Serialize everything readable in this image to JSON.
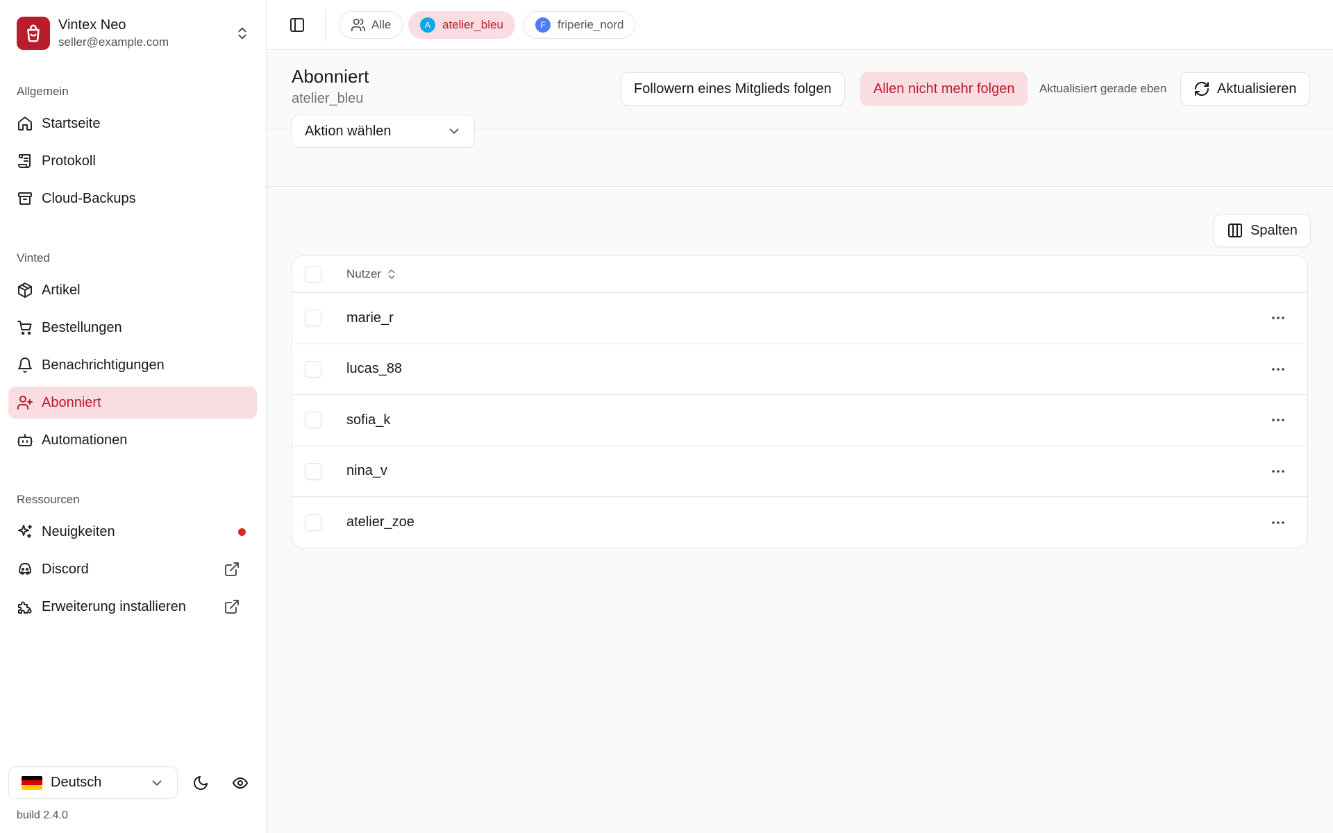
{
  "account": {
    "name": "Vintex Neo",
    "email": "seller@example.com"
  },
  "sidebar": {
    "sections": [
      {
        "label": "Allgemein"
      },
      {
        "label": "Vinted"
      },
      {
        "label": "Ressourcen"
      }
    ],
    "items": [
      {
        "label": "Startseite",
        "icon": "home-icon"
      },
      {
        "label": "Protokoll",
        "icon": "scroll-icon"
      },
      {
        "label": "Cloud-Backups",
        "icon": "archive-icon"
      },
      {
        "label": "Artikel",
        "icon": "package-icon"
      },
      {
        "label": "Bestellungen",
        "icon": "cart-icon"
      },
      {
        "label": "Benachrichtigungen",
        "icon": "bell-icon"
      },
      {
        "label": "Abonniert",
        "icon": "user-plus-icon",
        "active": true
      },
      {
        "label": "Automationen",
        "icon": "bot-icon"
      },
      {
        "label": "Neuigkeiten",
        "icon": "sparkles-icon",
        "badge": "red-dot"
      },
      {
        "label": "Discord",
        "icon": "discord-icon",
        "external": true
      },
      {
        "label": "Erweiterung installieren",
        "icon": "puzzle-icon",
        "external": true
      }
    ],
    "language": "Deutsch",
    "build": "build 2.4.0"
  },
  "topbar": {
    "chips": [
      {
        "label": "Alle"
      },
      {
        "label": "atelier_bleu",
        "avatar": "A",
        "active": true
      },
      {
        "label": "friperie_nord",
        "avatar": "F"
      }
    ]
  },
  "header": {
    "title": "Abonniert",
    "subtitle": "atelier_bleu",
    "follow_button": "Followern eines Mitglieds folgen",
    "unfollow_button": "Allen nicht mehr folgen",
    "updated": "Aktualisiert gerade eben",
    "refresh_button": "Aktualisieren"
  },
  "filter": {
    "action_select": "Aktion wählen"
  },
  "table": {
    "columns_button": "Spalten",
    "header": "Nutzer",
    "rows": [
      "marie_r",
      "lucas_88",
      "sofia_k",
      "nina_v",
      "atelier_zoe"
    ]
  },
  "colors": {
    "brand": "#b91c2c",
    "active_bg": "#f9dde1",
    "avatar_a": "#0ea5e9",
    "avatar_f": "#4f7df0"
  }
}
